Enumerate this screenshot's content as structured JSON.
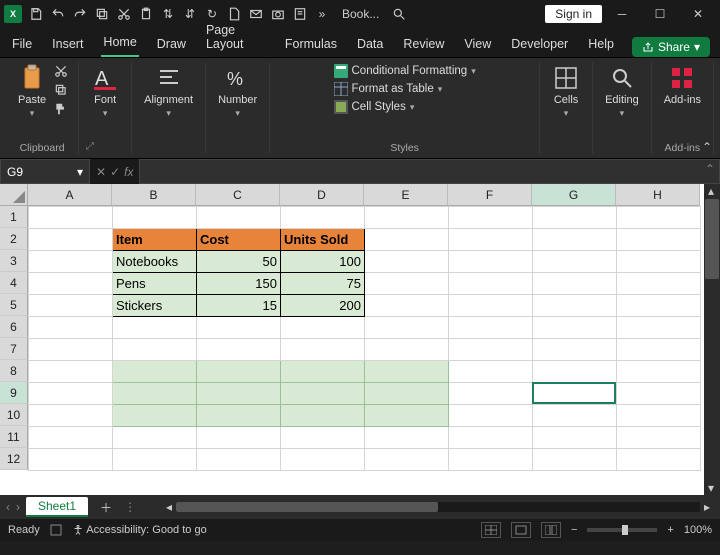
{
  "titlebar": {
    "app_badge": "X",
    "doc_title": "Book...",
    "signin": "Sign in"
  },
  "menus": [
    "File",
    "Insert",
    "Home",
    "Draw",
    "Page Layout",
    "Formulas",
    "Data",
    "Review",
    "View",
    "Developer",
    "Help"
  ],
  "active_menu": "Home",
  "share_label": "Share",
  "ribbon": {
    "clipboard": {
      "paste": "Paste",
      "group": "Clipboard"
    },
    "font": {
      "label": "Font"
    },
    "alignment": {
      "label": "Alignment"
    },
    "number": {
      "label": "Number"
    },
    "styles": {
      "group": "Styles",
      "cond": "Conditional Formatting",
      "table": "Format as Table",
      "cell": "Cell Styles"
    },
    "cells": {
      "label": "Cells"
    },
    "editing": {
      "label": "Editing"
    },
    "addins": {
      "label": "Add-ins",
      "group": "Add-ins"
    }
  },
  "namebox": "G9",
  "cols": [
    "A",
    "B",
    "C",
    "D",
    "E",
    "F",
    "G",
    "H"
  ],
  "rows": [
    "1",
    "2",
    "3",
    "4",
    "5",
    "6",
    "7",
    "8",
    "9",
    "10",
    "11",
    "12"
  ],
  "active_col_index": 6,
  "active_row_index": 8,
  "table1": {
    "headers": [
      "Item",
      "Cost",
      "Units Sold"
    ],
    "rows": [
      [
        "Notebooks",
        "50",
        "100"
      ],
      [
        "Pens",
        "150",
        "75"
      ],
      [
        "Stickers",
        "15",
        "200"
      ]
    ]
  },
  "sheets": {
    "active": "Sheet1"
  },
  "status": {
    "ready": "Ready",
    "access": "Accessibility: Good to go",
    "zoom": "100%"
  },
  "chart_data": {
    "type": "table",
    "columns": [
      "Item",
      "Cost",
      "Units Sold"
    ],
    "rows": [
      {
        "Item": "Notebooks",
        "Cost": 50,
        "Units Sold": 100
      },
      {
        "Item": "Pens",
        "Cost": 150,
        "Units Sold": 75
      },
      {
        "Item": "Stickers",
        "Cost": 15,
        "Units Sold": 200
      }
    ]
  }
}
